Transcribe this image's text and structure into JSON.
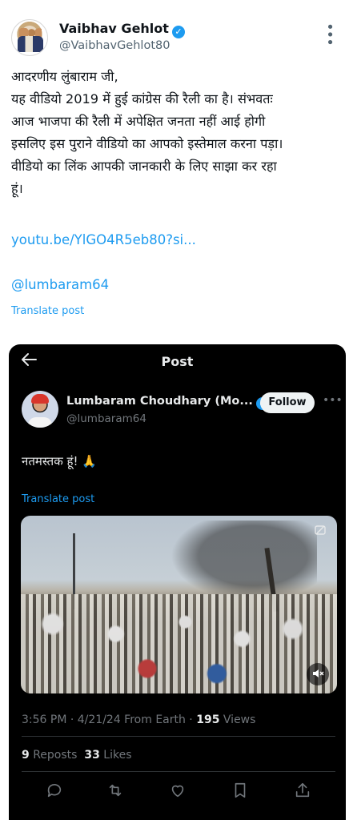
{
  "tweet": {
    "author_name": "Vaibhav Gehlot",
    "author_handle": "@VaibhavGehlot80",
    "text_lines": [
      "आदरणीय लुंबाराम जी,",
      "यह वीडियो 2019 में हुई कांग्रेस की रैली का है। संभवतः",
      "आज भाजपा की रैली में अपेक्षित जनता नहीं आई होगी",
      "इसलिए इस पुराने वीडियो का आपको इस्तेमाल करना पड़ा।",
      "वीडियो का लिंक आपकी जानकारी के लिए साझा कर रहा",
      "हूं।"
    ],
    "link": "youtu.be/YlGO4R5eb80?si...",
    "mention": "@lumbaram64",
    "translate_label": "Translate post"
  },
  "embed": {
    "header_title": "Post",
    "author_name": "Lumbaram Choudhary (Mo...",
    "author_handle": "@lumbaram64",
    "follow_label": "Follow",
    "text": "नतमस्तक हूं! 🙏",
    "translate_label": "Translate post",
    "time": "3:56 PM · 4/21/24 From Earth · ",
    "views_count": "195",
    "views_label": " Views",
    "reposts_count": "9",
    "reposts_label": " Reposts  ",
    "likes_count": "33",
    "likes_label": " Likes"
  },
  "icons": {
    "back": "arrow-left-icon",
    "verified": "verified-badge-icon",
    "more": "more-icon",
    "reply": "reply-icon",
    "repost": "repost-icon",
    "like": "heart-icon",
    "bookmark": "bookmark-icon",
    "share": "share-icon",
    "mute": "volume-muted-icon"
  },
  "colors": {
    "link": "#1d9bf0",
    "embed_bg": "#000000",
    "verified": "#1d9bf0"
  }
}
